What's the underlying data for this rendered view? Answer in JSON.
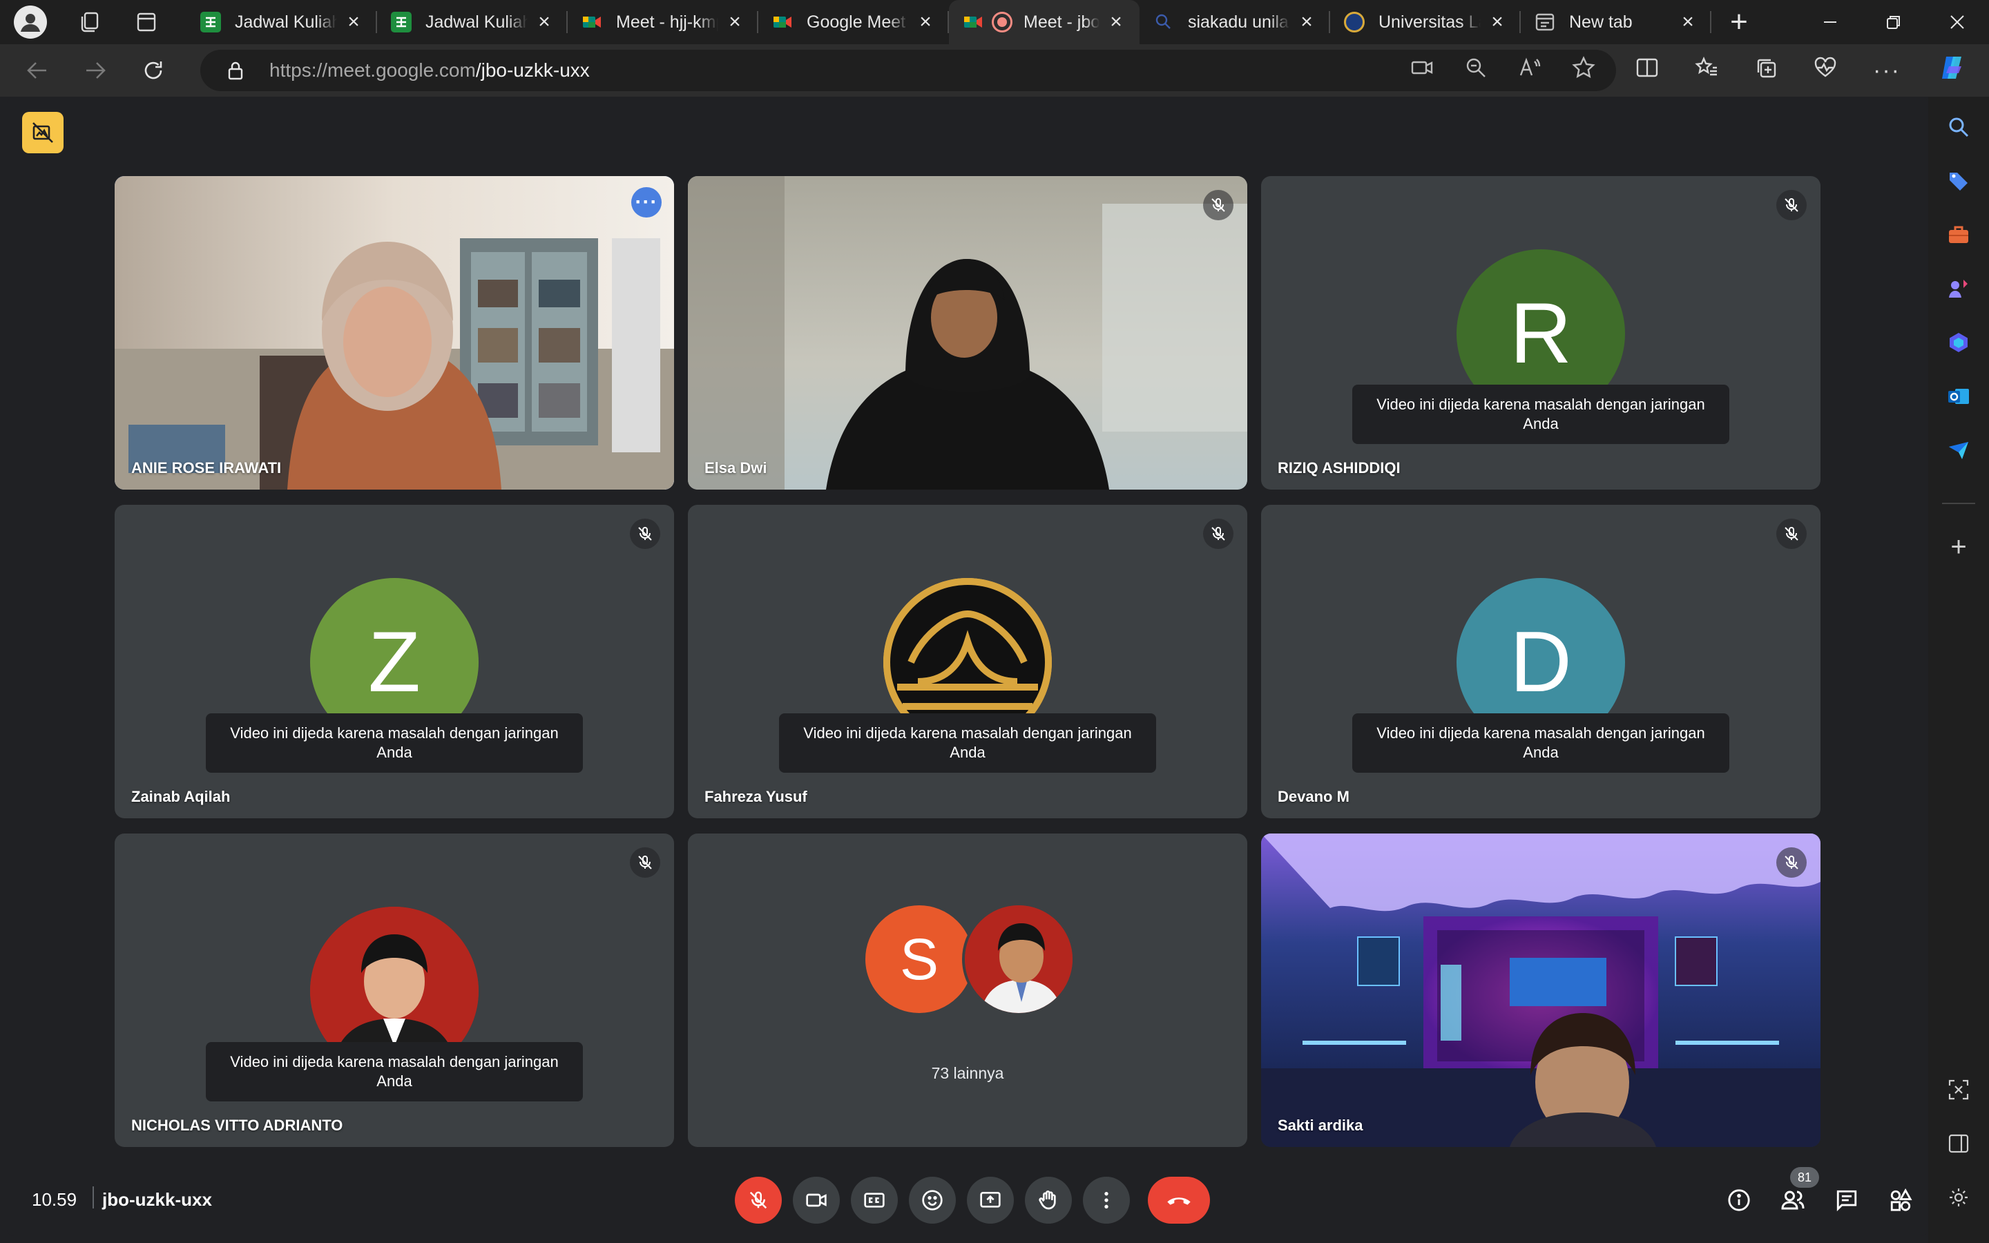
{
  "browser": {
    "tabs": [
      {
        "title": "Jadwal Kuliah",
        "favicon": "sheets-icon",
        "color": "#1e8e3e"
      },
      {
        "title": "Jadwal Kuliah",
        "favicon": "sheets-icon",
        "color": "#1e8e3e"
      },
      {
        "title": "Meet - hjj-kmpq-xqa",
        "favicon": "meet-icon",
        "color": "#00897b"
      },
      {
        "title": "Google Meet",
        "favicon": "meet-icon",
        "color": "#00897b"
      },
      {
        "title": "Meet - jbo-uzkk-uxx",
        "favicon": "meet-icon",
        "color": "#00897b",
        "active": true,
        "recording": true
      },
      {
        "title": "siakadu unila",
        "favicon": "search-icon",
        "color": "#5f6368"
      },
      {
        "title": "Universitas Lampung",
        "favicon": "unila-logo-icon",
        "color": "#1a73e8"
      },
      {
        "title": "New tab",
        "favicon": "newtab-icon",
        "color": "#bdbdbd"
      }
    ],
    "url_host": "https://meet.google.com",
    "url_path": "/jbo-uzkk-uxx"
  },
  "participants": [
    {
      "name": "ANIE ROSE IRAWATI",
      "type": "video",
      "speaking": true
    },
    {
      "name": "Elsa Dwi",
      "type": "video",
      "muted": true
    },
    {
      "name": "RIZIQ ASHIDDIQI",
      "type": "avatar",
      "initial": "R",
      "color": "#3f6d2a",
      "muted": true
    },
    {
      "name": "Zainab Aqilah",
      "type": "avatar",
      "initial": "Z",
      "color": "#6d9a3d",
      "muted": true
    },
    {
      "name": "Fahreza Yusuf",
      "type": "logo",
      "muted": true
    },
    {
      "name": "Devano M",
      "type": "avatar",
      "initial": "D",
      "color": "#3f8ea0",
      "muted": true
    },
    {
      "name": "NICHOLAS VITTO ADRIANTO",
      "type": "photo",
      "muted": true
    },
    {
      "name": "",
      "type": "others",
      "initial": "S",
      "color": "#e8592b"
    },
    {
      "name": "Sakti ardika",
      "type": "video",
      "muted": true
    }
  ],
  "paused_message": "Video ini dijeda karena masalah dengan jaringan Anda",
  "others_label": "73 lainnya",
  "meeting": {
    "time": "10.59",
    "code": "jbo-uzkk-uxx",
    "participant_count": "81"
  },
  "colors": {
    "accent": "#8ab4f8",
    "danger": "#ea4335",
    "tile": "#3c4043",
    "bg": "#202124"
  }
}
